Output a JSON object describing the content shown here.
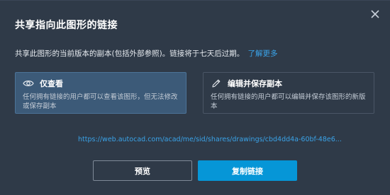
{
  "dialog": {
    "title": "共享指向此图形的链接",
    "description": "共享此图形的当前版本的副本(包括外部参照)。链接将于七天后过期。",
    "learn_more": "了解更多",
    "close_icon": "close-icon"
  },
  "options": [
    {
      "label": "仅查看",
      "description": "任何拥有链接的用户都可以查看该图形，但无法修改或保存副本",
      "icon": "eye-icon",
      "selected": true
    },
    {
      "label": "编辑并保存副本",
      "description": "任何拥有链接的用户都可以编辑并保存该图形的新版本",
      "icon": "pencil-icon",
      "selected": false
    }
  ],
  "link_url": "https://web.autocad.com/acad/me/sid/shares/drawings/cbd4dd4a-60bf-48e6...",
  "buttons": {
    "preview": "预览",
    "copy_link": "复制链接"
  },
  "colors": {
    "background": "#2f3a48",
    "accent": "#0696d7",
    "link": "#3aa3e8",
    "selected_option": "#3c5a78"
  }
}
